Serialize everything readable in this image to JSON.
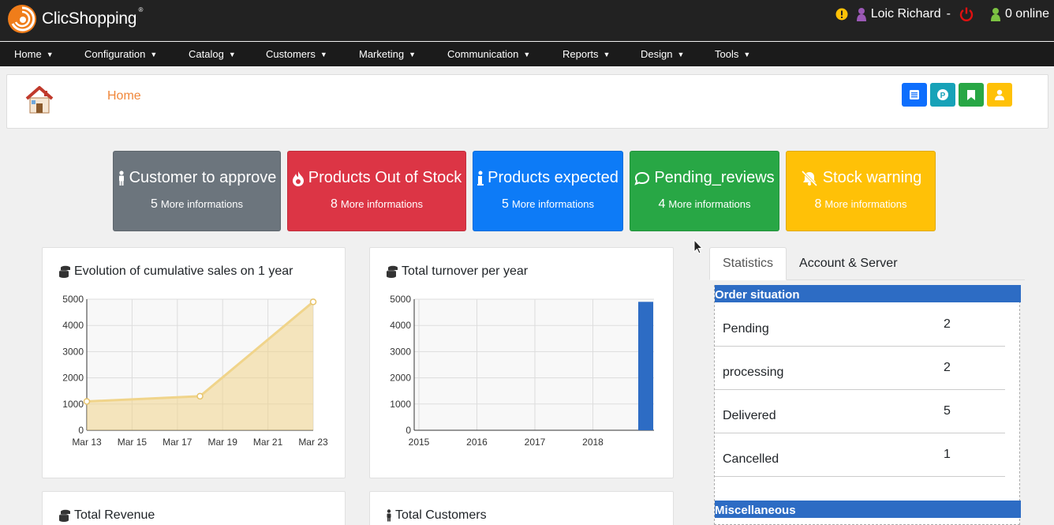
{
  "app": {
    "name": "ClicShopping",
    "reg": "®"
  },
  "user": {
    "name": "Loic Richard",
    "separator": "-",
    "online": "0 online"
  },
  "nav": [
    {
      "label": "Home"
    },
    {
      "label": "Configuration"
    },
    {
      "label": "Catalog"
    },
    {
      "label": "Customers"
    },
    {
      "label": "Marketing"
    },
    {
      "label": "Communication"
    },
    {
      "label": "Reports"
    },
    {
      "label": "Design"
    },
    {
      "label": "Tools"
    }
  ],
  "page": {
    "title": "Home"
  },
  "quick_buttons": [
    {
      "icon": "list-icon",
      "color": "#0d6efd"
    },
    {
      "icon": "parking-icon",
      "color": "#17a2b8"
    },
    {
      "icon": "bookmark-icon",
      "color": "#28a745"
    },
    {
      "icon": "user-icon",
      "color": "#ffc107"
    }
  ],
  "info_boxes": [
    {
      "title": "Customer to approve",
      "count": "5",
      "more": "More informations",
      "color": "#6c757d",
      "icon": "person-icon"
    },
    {
      "title": "Products Out of Stock",
      "count": "8",
      "more": "More informations",
      "color": "#dc3545",
      "icon": "fire-icon"
    },
    {
      "title": "Products expected",
      "count": "5",
      "more": "More informations",
      "color": "#0d7bf7",
      "icon": "info-icon"
    },
    {
      "title": "Pending_reviews",
      "count": "4",
      "more": "More informations",
      "color": "#28a745",
      "icon": "comment-icon"
    },
    {
      "title": "Stock warning",
      "count": "8",
      "more": "More informations",
      "color": "#ffc107",
      "icon": "bell-slash-icon"
    }
  ],
  "panels": {
    "sales": {
      "title": "Evolution of cumulative sales on 1 year"
    },
    "turnover": {
      "title": "Total turnover per year"
    },
    "revenue": {
      "title": "Total Revenue"
    },
    "customers": {
      "title": "Total Customers"
    }
  },
  "chart_data": [
    {
      "type": "area",
      "title": "Evolution of cumulative sales on 1 year",
      "x": [
        "Mar 13",
        "Mar 18",
        "Mar 23"
      ],
      "xticks": [
        "Mar 13",
        "Mar 15",
        "Mar 17",
        "Mar 19",
        "Mar 21",
        "Mar 23"
      ],
      "values": [
        1100,
        1300,
        4900
      ],
      "ylim": [
        0,
        5000
      ],
      "yticks": [
        0,
        1000,
        2000,
        3000,
        4000,
        5000
      ],
      "grid": true,
      "color": "#f0d48a"
    },
    {
      "type": "bar",
      "title": "Total turnover per year",
      "xticks": [
        "2015",
        "2016",
        "2017",
        "2018"
      ],
      "categories": [
        "2019"
      ],
      "values": [
        4900
      ],
      "ylim": [
        0,
        5000
      ],
      "yticks": [
        0,
        1000,
        2000,
        3000,
        4000,
        5000
      ],
      "grid": true,
      "color": "#2d6cc4"
    }
  ],
  "tabs": [
    {
      "label": "Statistics",
      "active": true
    },
    {
      "label": "Account & Server",
      "active": false
    }
  ],
  "stats": {
    "order_heading": "Order situation",
    "rows": [
      {
        "label": "Pending",
        "value": "2"
      },
      {
        "label": "processing",
        "value": "2"
      },
      {
        "label": "Delivered",
        "value": "5"
      },
      {
        "label": "Cancelled",
        "value": "1"
      }
    ],
    "misc_heading": "Miscellaneous"
  }
}
